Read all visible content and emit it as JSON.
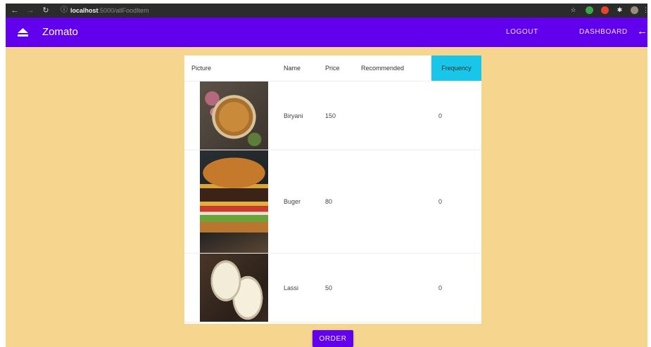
{
  "browser": {
    "url_host": "localhost",
    "url_path": ":5000/allFoodItem"
  },
  "appbar": {
    "title": "Zomato",
    "logout_label": "LOGOUT",
    "dashboard_label": "DASHBOARD"
  },
  "table": {
    "headers": [
      "Picture",
      "Name",
      "Price",
      "Recommended",
      "Frequency"
    ],
    "rows": [
      {
        "image": "biryani-photo",
        "name": "Biryani",
        "price": "150",
        "recommended": "",
        "frequency": "0"
      },
      {
        "image": "burger-photo",
        "name": "Buger",
        "price": "80",
        "recommended": "",
        "frequency": "0"
      },
      {
        "image": "lassi-photo",
        "name": "Lassi",
        "price": "50",
        "recommended": "",
        "frequency": "0"
      }
    ]
  },
  "order_label": "ORDER",
  "colors": {
    "primary": "#6200ee",
    "background": "#f6d58f",
    "frequency_header": "#17c6e8"
  }
}
